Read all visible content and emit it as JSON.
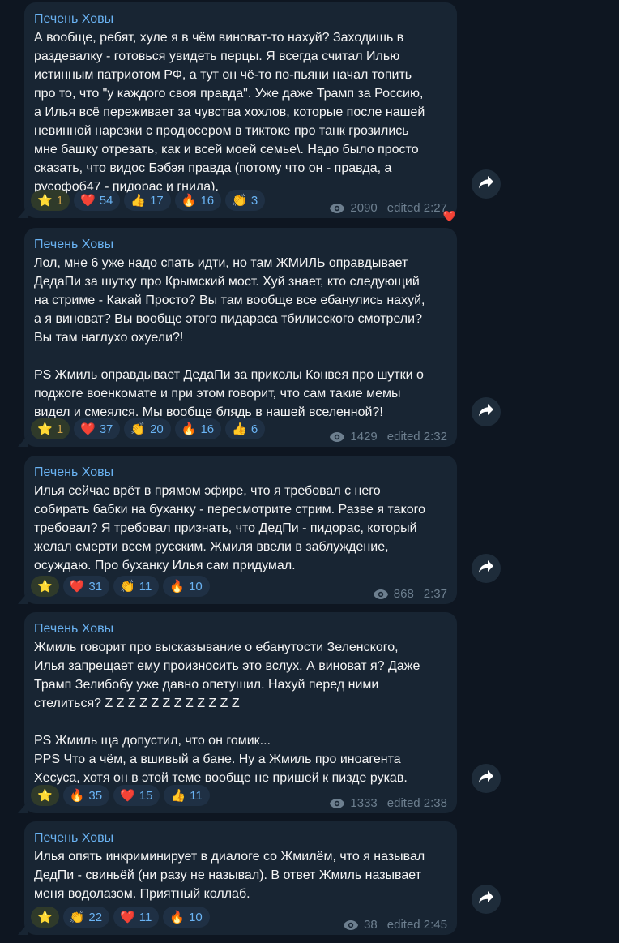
{
  "messages": [
    {
      "author": "Печень Ховы",
      "text": "А вообще, ребят, хуле я в чём виноват-то нахуй? Заходишь в\nраздевалку - готовься увидеть перцы. Я всегда считал Илью\nистинным патриотом РФ, а тут он чё-то по-пьяни начал топить\nпро то, что \"у каждого своя правда\". Уже даже Трамп за Россию,\nа Илья всё переживает за чувства хохлов, которые после нашей\nневинной нарезки с продюсером в тиктоке про танк грозились\nмне башку отрезать, как и всей моей семье\\. Надо было просто\nсказать, что видос Бэбэя правда (потому что он - правда, а\nрусофоб47 - пидорас и гнида).",
      "reactions": [
        {
          "icon": "star-icon",
          "emoji": "⭐",
          "count": "1",
          "type": "star"
        },
        {
          "icon": "heart-icon",
          "emoji": "❤️",
          "count": "54"
        },
        {
          "icon": "thumbs-up-icon",
          "emoji": "👍",
          "count": "17"
        },
        {
          "icon": "fire-icon",
          "emoji": "🔥",
          "count": "16"
        },
        {
          "icon": "clap-icon",
          "emoji": "👏",
          "count": "3"
        }
      ],
      "views": "2090",
      "time": "edited 2:27",
      "my_reaction": "❤️"
    },
    {
      "author": "Печень Ховы",
      "text": "Лол, мне 6 уже надо спать идти, но там ЖМИЛЬ оправдывает\nДедаПи за шутку про Крымский мост. Хуй знает, кто следующий\nна стриме - Какай Просто? Вы там вообще все ебанулись нахуй,\nа я виноват? Вы вообще этого пидараса тбилисского смотрели?\nВы там наглухо охуели?!\n\nPS Жмиль оправдывает ДедаПи за приколы Конвея про шутки о\nподжоге военкомате и при этом говорит, что сам такие мемы\nвидел и смеялся. Мы вообще блядь в нашей вселенной?!",
      "reactions": [
        {
          "icon": "star-icon",
          "emoji": "⭐",
          "count": "1",
          "type": "star"
        },
        {
          "icon": "heart-icon",
          "emoji": "❤️",
          "count": "37"
        },
        {
          "icon": "clap-icon",
          "emoji": "👏",
          "count": "20"
        },
        {
          "icon": "fire-icon",
          "emoji": "🔥",
          "count": "16"
        },
        {
          "icon": "thumbs-up-icon",
          "emoji": "👍",
          "count": "6"
        }
      ],
      "views": "1429",
      "time": "edited 2:32"
    },
    {
      "author": "Печень Ховы",
      "text": "Илья сейчас врёт в прямом эфире, что я требовал с него\nсобирать бабки на буханку - пересмотрите стрим. Разве я такого\nтребовал? Я требовал признать, что ДедПи - пидорас, который\nжелал смерти всем русским. Жмиля ввели в заблуждение,\nосуждаю. Про буханку Илья сам придумал.",
      "reactions": [
        {
          "icon": "star-icon",
          "emoji": "⭐",
          "count": "",
          "type": "star"
        },
        {
          "icon": "heart-icon",
          "emoji": "❤️",
          "count": "31"
        },
        {
          "icon": "clap-icon",
          "emoji": "👏",
          "count": "11"
        },
        {
          "icon": "fire-icon",
          "emoji": "🔥",
          "count": "10"
        }
      ],
      "views": "868",
      "time": "2:37"
    },
    {
      "author": "Печень Ховы",
      "text": "Жмиль говорит про высказывание о ебанутости Зеленского,\nИлья запрещает ему произносить это вслух. А виноват я? Даже\nТрамп Зелибобу уже давно опетушил. Нахуй перед ними\nстелиться? Z Z Z Z Z Z Z Z Z Z Z Z\n\nPS Жмиль ща допустил, что он гомик...\nPPS Что а чём, а вшивый а бане. Ну а Жмиль про иноагента\nХесуса, хотя он в этой теме вообще не пришей к пизде рукав.",
      "reactions": [
        {
          "icon": "star-icon",
          "emoji": "⭐",
          "count": "",
          "type": "star"
        },
        {
          "icon": "fire-icon",
          "emoji": "🔥",
          "count": "35"
        },
        {
          "icon": "heart-icon",
          "emoji": "❤️",
          "count": "15"
        },
        {
          "icon": "thumbs-up-icon",
          "emoji": "👍",
          "count": "11"
        }
      ],
      "views": "1333",
      "time": "edited 2:38"
    },
    {
      "author": "Печень Ховы",
      "text": "Илья опять инкриминирует в диалоге со Жмилём, что я называл\nДедПи - свиньёй (ни разу не называл). В ответ Жмиль называет\nменя водолазом. Приятный коллаб.",
      "reactions": [
        {
          "icon": "star-icon",
          "emoji": "⭐",
          "count": "",
          "type": "star"
        },
        {
          "icon": "clap-icon",
          "emoji": "👏",
          "count": "22"
        },
        {
          "icon": "heart-icon",
          "emoji": "❤️",
          "count": "11"
        },
        {
          "icon": "fire-icon",
          "emoji": "🔥",
          "count": "10"
        }
      ],
      "views": "38",
      "time": "edited 2:45"
    }
  ],
  "share_icon": "share-arrow-icon",
  "colors": {
    "background": "#0e1621",
    "bubble": "#182533",
    "author": "#6ab3f3",
    "text": "#f5f5f5",
    "meta": "#6d7f8f"
  }
}
